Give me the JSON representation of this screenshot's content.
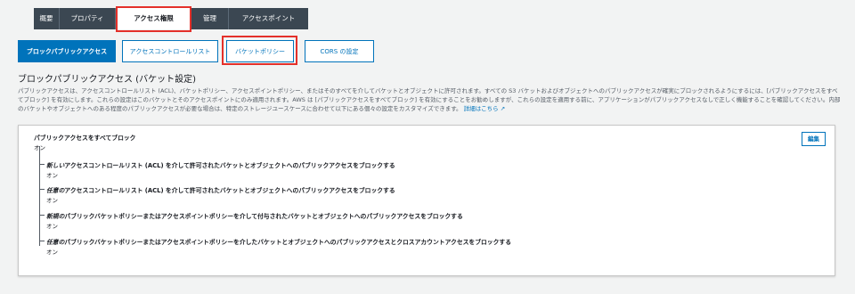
{
  "top_tabs": [
    {
      "label": "概要"
    },
    {
      "label": "プロパティ"
    },
    {
      "label": "アクセス権限"
    },
    {
      "label": "管理"
    },
    {
      "label": "アクセスポイント"
    }
  ],
  "sub_tabs": [
    {
      "label": "ブロックパブリックアクセス"
    },
    {
      "label": "アクセスコントロールリスト"
    },
    {
      "label": "バケットポリシー"
    },
    {
      "label": "CORS の設定"
    }
  ],
  "section": {
    "title": "ブロックパブリックアクセス (バケット設定)",
    "description": "パブリックアクセスは、アクセスコントロールリスト (ACL)、バケットポリシー、アクセスポイントポリシー、またはそのすべてを介してバケットとオブジェクトに許可されます。すべての S3 バケットおよびオブジェクトへのパブリックアクセスが確実にブロックされるようにするには、[パブリックアクセスをすべてブロック] を有効にします。これらの設定はこのバケットとそのアクセスポイントにのみ適用されます。AWS は [パブリックアクセスをすべてブロック] を有効にすることをお勧めしますが、これらの設定を適用する前に、アプリケーションがパブリックアクセスなしで正しく機能することを確認してください。内部のバケットやオブジェクトへのある程度のパブリックアクセスが必要な場合は、特定のストレージユースケースに合わせて以下にある個々の設定をカスタマイズできます。",
    "learn_more": "詳細はこちら ↗"
  },
  "panel": {
    "edit_label": "編集",
    "main_setting": {
      "label": "パブリックアクセスをすべてブロック",
      "value": "オン"
    },
    "children": [
      {
        "prefix": "新しい",
        "rest": "アクセスコントロールリスト (ACL) を介して許可されたバケットとオブジェクトへのパブリックアクセスをブロックする",
        "value": "オン"
      },
      {
        "prefix": "任意の",
        "rest": "アクセスコントロールリスト (ACL) を介して許可されたバケットとオブジェクトへのパブリックアクセスをブロックする",
        "value": "オン"
      },
      {
        "prefix": "新規の",
        "rest": "パブリックバケットポリシーまたはアクセスポイントポリシーを介して付与されたバケットとオブジェクトへのパブリックアクセスをブロックする",
        "value": "オン"
      },
      {
        "prefix": "任意の",
        "rest": "パブリックバケットポリシーまたはアクセスポイントポリシーを介したバケットとオブジェクトへのパブリックアクセスとクロスアカウントアクセスをブロックする",
        "value": "オン"
      }
    ]
  },
  "colors": {
    "highlight": "#e4302a",
    "accent": "#0073bb",
    "tab_bar": "#3b4752"
  }
}
